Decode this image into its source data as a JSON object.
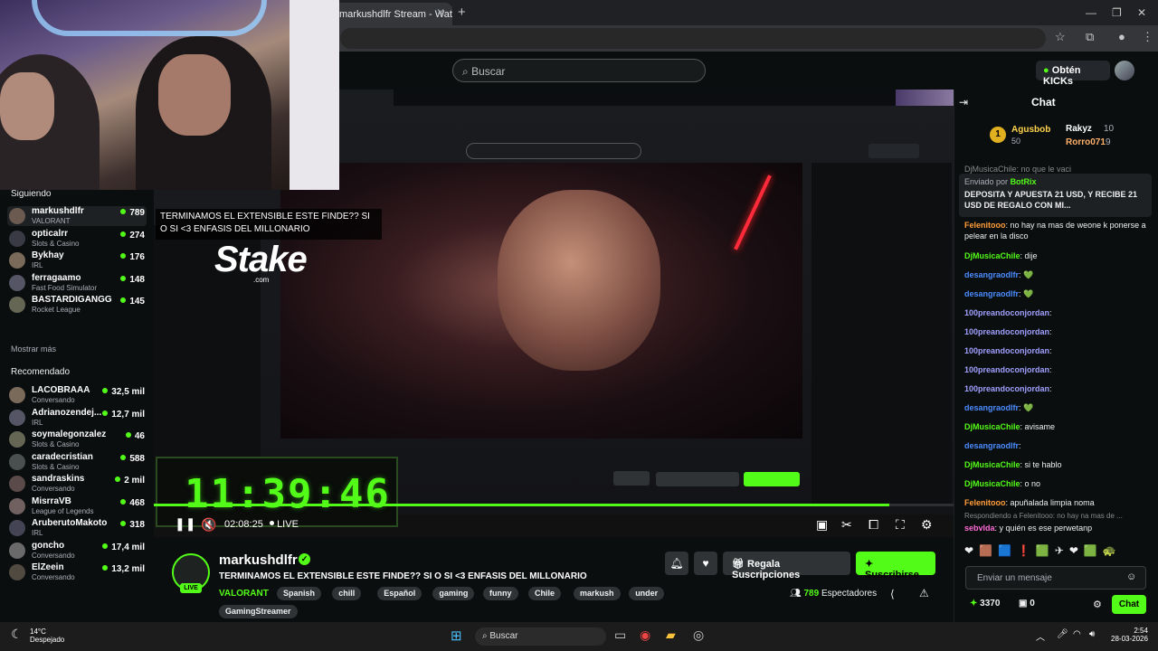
{
  "browser": {
    "tab_title": "markushdlfr Stream - Watch Li...",
    "close_x": "✕",
    "new_tab": "+"
  },
  "header": {
    "search_placeholder": "Buscar",
    "obten_kicks": "Obtén KICKs"
  },
  "sidebar": {
    "following_title": "Siguiendo",
    "following": [
      {
        "name": "markushdlfr",
        "game": "VALORANT",
        "viewers": "789"
      },
      {
        "name": "opticalrr",
        "game": "Slots & Casino",
        "viewers": "274"
      },
      {
        "name": "Bykhay",
        "game": "IRL",
        "viewers": "176"
      },
      {
        "name": "ferragaamo",
        "game": "Fast Food Simulator",
        "viewers": "148"
      },
      {
        "name": "BASTARDIGANGG",
        "game": "Rocket League",
        "viewers": "145"
      }
    ],
    "show_more": "Mostrar más",
    "recommended_title": "Recomendado",
    "recommended": [
      {
        "name": "LACOBRAAA",
        "game": "Conversando",
        "viewers": "32,5 mil"
      },
      {
        "name": "Adrianozendej...",
        "game": "IRL",
        "viewers": "12,7 mil"
      },
      {
        "name": "soymalegonzalez",
        "game": "Slots & Casino",
        "viewers": "46"
      },
      {
        "name": "caradecristian",
        "game": "Slots & Casino",
        "viewers": "588"
      },
      {
        "name": "sandraskins",
        "game": "Conversando",
        "viewers": "2 mil"
      },
      {
        "name": "MisrraVB",
        "game": "League of Legends",
        "viewers": "468"
      },
      {
        "name": "AruberutoMakoto",
        "game": "IRL",
        "viewers": "318"
      },
      {
        "name": "goncho",
        "game": "Conversando",
        "viewers": "17,4 mil"
      },
      {
        "name": "ElZeein",
        "game": "Conversando",
        "viewers": "13,2 mil"
      }
    ]
  },
  "overlay": {
    "title_text": "TERMINAMOS EL EXTENSIBLE ESTE FINDE?? SI O SI <3 ENFASIS DEL MILLONARIO",
    "stake_logo": "Stake",
    "stake_com": ".com",
    "timer": "11:39:46"
  },
  "player": {
    "time": "02:08:25",
    "live": "LIVE",
    "progress": 0.92
  },
  "stream": {
    "streamer": "markushdlfr",
    "live_badge": "LIVE",
    "title": "TERMINAMOS EL EXTENSIBLE ESTE FINDE?? SI O SI <3 ENFASIS DEL MILLONARIO",
    "category": "VALORANT",
    "tags": [
      "Spanish",
      "chill",
      "Español",
      "gaming",
      "funny",
      "Chile",
      "markush",
      "under",
      "GamingStreamer"
    ],
    "regala": "Regala Suscripciones",
    "suscribirse": "Suscribirse",
    "viewers_count": "789",
    "viewers_label": "Espectadores"
  },
  "chat": {
    "title": "Chat",
    "top": [
      {
        "name": "Agusbob",
        "value": "50"
      },
      {
        "name": "Rakyz",
        "value": "10"
      },
      {
        "name": "Rorro071",
        "value": "9"
      }
    ],
    "partial_top": "DjMusicaChile: no que le vaci",
    "pinned_by": "Enviado por",
    "pinned_user": "BotRix",
    "pinned_text": "DEPOSITA Y APUESTA 21 USD, Y RECIBE 21 USD DE REGALO CON MI...",
    "messages": [
      {
        "user": "Felenitooo",
        "text": "no hay na mas de weone k ponerse a pelear en la disco",
        "color": "#ff9d3a"
      },
      {
        "user": "DjMusicaChile",
        "text": "dije",
        "color": "#53fc18"
      },
      {
        "user": "desangraodlfr",
        "text": "💚",
        "color": "#4a8cff"
      },
      {
        "user": "desangraodlfr",
        "text": "💚",
        "color": "#4a8cff"
      },
      {
        "user": "100preandoconjordan",
        "text": "",
        "color": "#a0a0ff"
      },
      {
        "user": "100preandoconjordan",
        "text": "",
        "color": "#a0a0ff"
      },
      {
        "user": "100preandoconjordan",
        "text": "",
        "color": "#a0a0ff"
      },
      {
        "user": "100preandoconjordan",
        "text": "",
        "color": "#a0a0ff"
      },
      {
        "user": "100preandoconjordan",
        "text": "",
        "color": "#a0a0ff"
      },
      {
        "user": "desangraodlfr",
        "text": "💚",
        "color": "#4a8cff"
      },
      {
        "user": "DjMusicaChile",
        "text": "avisame",
        "color": "#53fc18"
      },
      {
        "user": "desangraodlfr",
        "text": "",
        "color": "#4a8cff"
      },
      {
        "user": "DjMusicaChile",
        "text": "si te hablo",
        "color": "#53fc18"
      },
      {
        "user": "DjMusicaChile",
        "text": "o no",
        "color": "#53fc18"
      },
      {
        "user": "Felenitooo",
        "text": "apuñalada limpia noma",
        "color": "#ff9d3a"
      }
    ],
    "reply_note": "Respondiendo a Felenitooo: no hay na mas de ...",
    "last_user": "sebvlda",
    "last_text": "y quién es ese perwetanp",
    "input_placeholder": "Enviar un mensaje",
    "points": "3370",
    "zero": "0",
    "send": "Chat"
  },
  "taskbar": {
    "weather_temp": "14°C",
    "weather_desc": "Despejado",
    "search": "Buscar",
    "time": "2:54",
    "date": "28-03-2026"
  }
}
